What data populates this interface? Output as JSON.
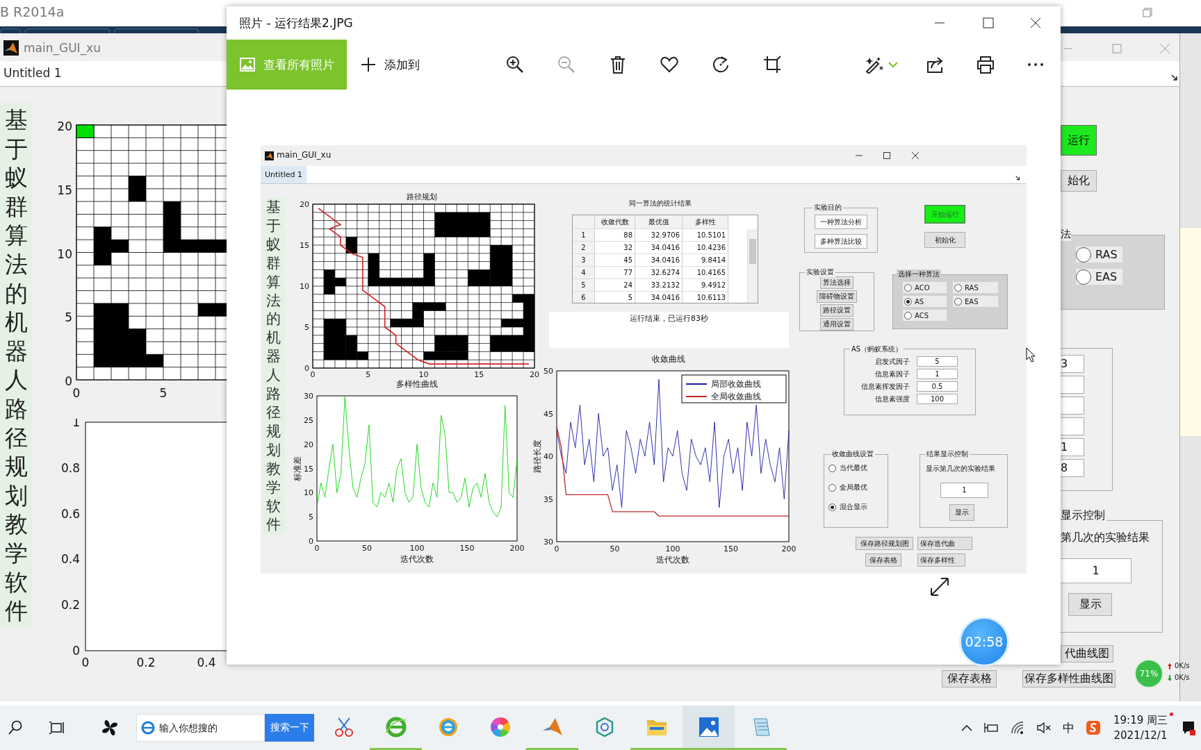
{
  "matlab_window": {
    "title": "B R2014a"
  },
  "back_figure": {
    "title": "main_GUI_xu",
    "menu": "Untitled 1",
    "vertical_title": "基于蚁群算法的机器人路径规划教学软件",
    "map_axes": {
      "yticks": [
        "20",
        "15",
        "10",
        "5",
        "0"
      ],
      "xticks": [
        "0",
        "5"
      ]
    },
    "empty_axes": {
      "yticks": [
        "1",
        "0.8",
        "0.6",
        "0.4",
        "0.2",
        "0"
      ],
      "xticks": [
        "0",
        "0.2",
        "0.4"
      ]
    },
    "run_button": "运行",
    "init_button": "始化",
    "algorithm_group_label": "法",
    "algorithm_options": [
      {
        "label": "RAS",
        "selected": false
      },
      {
        "label": "EAS",
        "selected": false
      }
    ],
    "parameter_fields": [
      {
        "kind": "filled",
        "value": "3"
      },
      {
        "kind": "blank"
      },
      {
        "kind": "blank"
      },
      {
        "kind": "blank"
      },
      {
        "kind": "filled",
        "value": "1"
      },
      {
        "kind": "filled",
        "value": "8"
      }
    ],
    "result_group_label": "显示控制",
    "result_prompt": "第几次的实验结果",
    "result_value": "1",
    "show_button": "显示",
    "save_buttons": [
      "代曲线图",
      "保存表格",
      "保存多样性曲线图"
    ]
  },
  "photos_window": {
    "title": "照片 - 运行结果2.JPG",
    "view_all_button": "查看所有照片",
    "add_to_button": "添加到",
    "toolbar_left": [
      {
        "kind": "zoom-in",
        "disabled": false
      },
      {
        "kind": "zoom-out",
        "disabled": true
      },
      {
        "kind": "delete",
        "disabled": false
      },
      {
        "kind": "favorite",
        "disabled": false
      },
      {
        "kind": "rotate",
        "disabled": false
      },
      {
        "kind": "crop",
        "disabled": false
      }
    ],
    "toolbar_right": [
      {
        "kind": "edit",
        "disabled": false
      },
      {
        "kind": "share",
        "disabled": false
      },
      {
        "kind": "print",
        "disabled": false
      },
      {
        "kind": "more",
        "disabled": false
      }
    ],
    "timer": "02:58",
    "photo": {
      "title": "main_GUI_xu",
      "menu": "Untitled 1",
      "vertical_title": "基于蚁群算法的机器人路径规划教学软件",
      "map": {
        "title": "路径规划",
        "xticks": [
          "0",
          "5",
          "10",
          "15",
          "20"
        ],
        "yticks": [
          "20",
          "15",
          "10",
          "5",
          "0"
        ]
      },
      "stats_table": {
        "title": "同一算法的统计结果",
        "columns": [
          "收敛代数",
          "最优值",
          "多样性"
        ],
        "rows": [
          {
            "index": "1",
            "cells": [
              "88",
              "32.9706",
              "10.5101"
            ]
          },
          {
            "index": "2",
            "cells": [
              "32",
              "34.0416",
              "10.4236"
            ]
          },
          {
            "index": "3",
            "cells": [
              "45",
              "34.0416",
              "9.8414"
            ]
          },
          {
            "index": "4",
            "cells": [
              "77",
              "32.6274",
              "10.4165"
            ]
          },
          {
            "index": "5",
            "cells": [
              "24",
              "33.2132",
              "9.4912"
            ]
          },
          {
            "index": "6",
            "cells": [
              "5",
              "34.0416",
              "10.6113"
            ]
          }
        ]
      },
      "status_text": "运行结束，已运行83秒",
      "diversity_plot": {
        "chart_data": {
          "type": "line",
          "title": "多样性曲线",
          "xlabel": "迭代次数",
          "ylabel": "标准差",
          "xlim": [
            0,
            200
          ],
          "ylim": [
            0,
            30
          ],
          "xticks": [
            0,
            50,
            100,
            150,
            200
          ],
          "yticks": [
            30,
            25,
            20,
            15,
            10,
            5,
            0
          ],
          "x": [
            0,
            4,
            8,
            12,
            16,
            20,
            24,
            28,
            32,
            36,
            40,
            44,
            48,
            52,
            56,
            60,
            64,
            68,
            72,
            76,
            80,
            84,
            88,
            92,
            96,
            100,
            104,
            108,
            112,
            116,
            120,
            124,
            128,
            132,
            136,
            140,
            144,
            148,
            152,
            156,
            160,
            164,
            168,
            172,
            176,
            180,
            184,
            188,
            192,
            196,
            200
          ],
          "series": [
            {
              "color": "#22dd22",
              "values": [
                7,
                12,
                9,
                15,
                20,
                10,
                14,
                30,
                19,
                11,
                9,
                13,
                16,
                24,
                8,
                7,
                10,
                9,
                12,
                8,
                15,
                17,
                10,
                8,
                9,
                20,
                11,
                8,
                7,
                12,
                9,
                26,
                22,
                10,
                10,
                8,
                9,
                13,
                7,
                11,
                12,
                9,
                14,
                8,
                6,
                5,
                7,
                28,
                10,
                9,
                17
              ]
            }
          ]
        }
      },
      "convergence_plot": {
        "chart_data": {
          "type": "line",
          "legend": true,
          "title": "收敛曲线",
          "xlabel": "迭代次数",
          "ylabel": "路径长度",
          "xlim": [
            0,
            200
          ],
          "ylim": [
            30,
            50
          ],
          "xticks": [
            0,
            50,
            100,
            150,
            200
          ],
          "yticks": [
            50,
            45,
            40,
            35,
            30
          ],
          "x": [
            0,
            4,
            8,
            12,
            16,
            20,
            24,
            28,
            32,
            36,
            40,
            44,
            48,
            52,
            56,
            60,
            64,
            68,
            72,
            76,
            80,
            84,
            88,
            92,
            96,
            100,
            104,
            108,
            112,
            116,
            120,
            124,
            128,
            132,
            136,
            140,
            144,
            148,
            152,
            156,
            160,
            164,
            168,
            172,
            176,
            180,
            184,
            188,
            192,
            196,
            200
          ],
          "series": [
            {
              "name": "局部收敛曲线",
              "color": "#1a1aa6",
              "values": [
                43,
                40,
                38,
                44,
                41,
                46,
                39,
                42,
                37,
                45,
                40,
                41,
                36,
                39,
                34,
                43,
                41,
                38,
                42,
                40,
                44,
                39,
                49,
                37,
                41,
                40,
                43,
                38,
                36,
                42,
                40,
                39,
                41,
                37,
                44,
                34,
                40,
                42,
                38,
                41,
                36,
                44,
                40,
                46,
                38,
                42,
                39,
                37,
                41,
                35,
                43
              ]
            },
            {
              "name": "全局收敛曲线",
              "color": "#c0282a",
              "values": [
                43.5,
                41,
                35.5,
                35.5,
                35.5,
                35.5,
                35.5,
                35.5,
                35.5,
                35.5,
                35.5,
                35.5,
                33.5,
                33.5,
                33.5,
                33.5,
                33.5,
                33.5,
                33.5,
                33.5,
                33.5,
                33.5,
                33,
                33,
                33,
                33,
                33,
                33,
                33,
                33,
                33,
                33,
                33,
                33,
                33,
                33,
                33,
                33,
                33,
                33,
                33,
                33,
                33,
                33,
                33,
                33,
                33,
                33,
                33,
                33,
                33
              ]
            }
          ]
        }
      },
      "purpose_group": {
        "label": "实验目的",
        "buttons": [
          "一种算法分析",
          "多种算法比较"
        ]
      },
      "run_button": "开始运行",
      "init_button": "初始化",
      "settings_group": {
        "label": "实验设置",
        "buttons": [
          "算法选择",
          "障碍物设置",
          "路径设置",
          "通用设置"
        ]
      },
      "algorithm_group": {
        "label": "选择一种算法",
        "options": [
          {
            "label": "ACO",
            "selected": false
          },
          {
            "label": "RAS",
            "selected": false
          },
          {
            "label": "AS",
            "selected": true
          },
          {
            "label": "EAS",
            "selected": false
          },
          {
            "label": "ACS",
            "selected": false
          }
        ]
      },
      "parameters_group": {
        "label": "AS（蚂蚁系统）",
        "rows": [
          {
            "label": "启发式因子",
            "value": "5"
          },
          {
            "label": "信息素因子",
            "value": "1"
          },
          {
            "label": "信息素挥发因子",
            "value": "0.5"
          },
          {
            "label": "信息素强度",
            "value": "100"
          }
        ]
      },
      "curve_group": {
        "label": "收敛曲线设置",
        "options": [
          {
            "label": "当代最优",
            "selected": false
          },
          {
            "label": "全局最优",
            "selected": false
          },
          {
            "label": "混合显示",
            "selected": true
          }
        ]
      },
      "result_group": {
        "label": "结果显示控制",
        "prompt": "显示第几次的实验结果",
        "value": "1",
        "button": "显示"
      },
      "save_buttons": [
        "保存路径规划图",
        "保存迭代曲",
        "保存表格",
        "保存多样性"
      ]
    }
  },
  "network_monitor": {
    "percent": "71%",
    "upload": "0K/s",
    "download": "0K/s"
  },
  "taskbar": {
    "search_placeholder": "输入你想搜的",
    "search_button": "搜索一下",
    "apps": [
      {
        "kind": "scissors",
        "running": false,
        "selected": false
      },
      {
        "kind": "browser",
        "running": true,
        "selected": false
      },
      {
        "kind": "ring",
        "running": false,
        "selected": false
      },
      {
        "kind": "pinwheel",
        "running": false,
        "selected": false
      },
      {
        "kind": "cone",
        "running": true,
        "selected": false
      },
      {
        "kind": "swirl",
        "running": false,
        "selected": false
      },
      {
        "kind": "folder",
        "running": true,
        "selected": false
      },
      {
        "kind": "photos",
        "running": true,
        "selected": true
      },
      {
        "kind": "notepad",
        "running": true,
        "selected": false
      }
    ],
    "input_method": "中",
    "time": "19:19 周三",
    "date": "2021/12/1"
  }
}
